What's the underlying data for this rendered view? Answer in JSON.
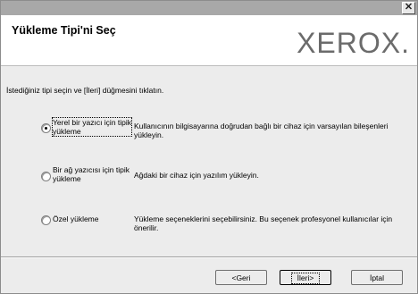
{
  "window": {
    "close_glyph": "✕"
  },
  "header": {
    "title": "Yükleme Tipi'ni Seç",
    "logo_text": "XEROX."
  },
  "instruction": "İstediğiniz tipi seçin ve [İleri] düğmesini tıklatın.",
  "options": [
    {
      "label": "Yerel bir yazıcı için tipik\nyükleme",
      "description": "Kullanıcının bilgisayarına doğrudan bağlı bir cihaz için varsayılan bileşenleri yükleyin.",
      "selected": true
    },
    {
      "label": "Bir ağ yazıcısı için tipik\nyükleme",
      "description": "Ağdaki bir cihaz için yazılım yükleyin.",
      "selected": false
    },
    {
      "label": "Özel yükleme",
      "description": "Yükleme seçeneklerini seçebilirsiniz. Bu seçenek profesyonel kullanıcılar için önerilir.",
      "selected": false
    }
  ],
  "buttons": {
    "back": "<Geri",
    "next": "İleri>",
    "cancel": "İptal"
  }
}
